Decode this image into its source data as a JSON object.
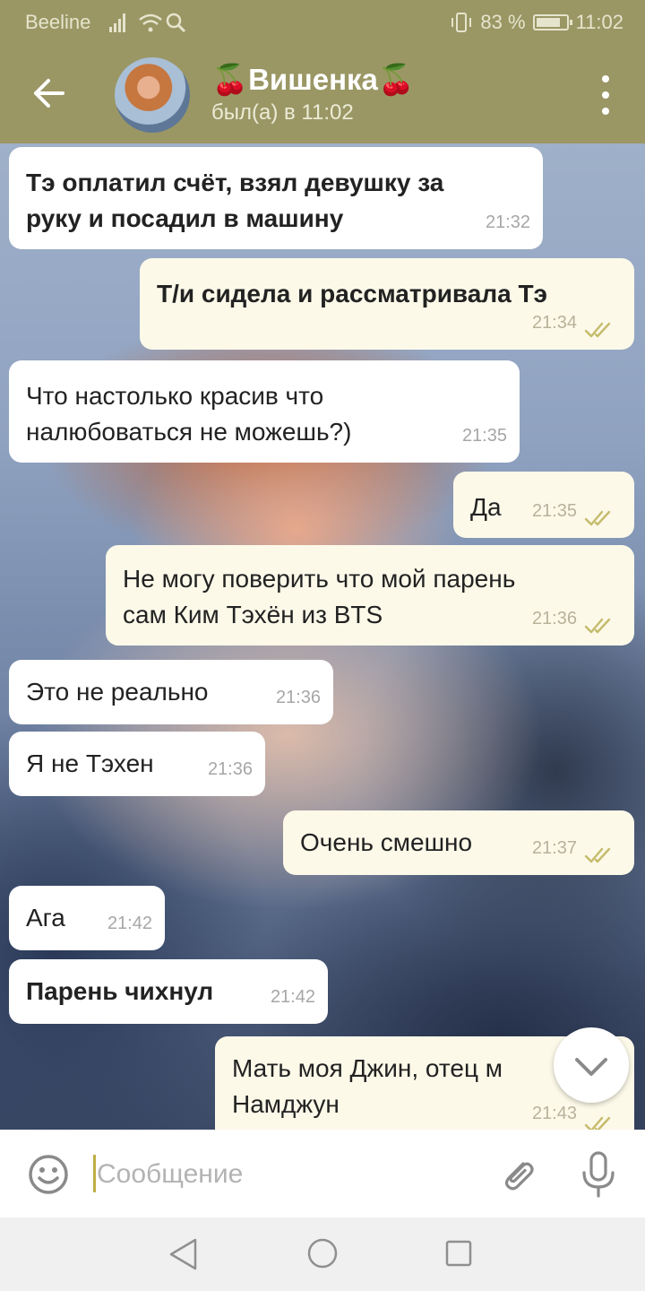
{
  "status_bar": {
    "carrier": "Beeline",
    "battery": "83 %",
    "battery_level": 0.83,
    "time": "11:02"
  },
  "header": {
    "name": "Вишенка",
    "emoji": "🍒",
    "status": "был(а) в 11:02",
    "icons": [
      "back-arrow-icon",
      "avatar",
      "more-vertical-icon"
    ]
  },
  "messages": [
    {
      "direction": "in",
      "text": "Тэ оплатил счёт, взял девушку за\nруку и посадил в машину",
      "time": "21:32",
      "bold": true
    },
    {
      "direction": "out",
      "text": "Т/и сидела и рассматривала Тэ",
      "time": "21:34",
      "bold": true,
      "read": true
    },
    {
      "direction": "in",
      "text": "Что настолько красив что\nналюбоваться не можешь?)",
      "time": "21:35",
      "bold": false
    },
    {
      "direction": "out",
      "text": "Да",
      "time": "21:35",
      "bold": false,
      "read": true
    },
    {
      "direction": "out",
      "text": "Не могу поверить что мой парень\nсам Ким Тэхён из BTS",
      "time": "21:36",
      "bold": false,
      "read": true
    },
    {
      "direction": "in",
      "text": "Это не реально",
      "time": "21:36",
      "bold": false
    },
    {
      "direction": "in",
      "text": "Я не Тэхен",
      "time": "21:36",
      "bold": false
    },
    {
      "direction": "out",
      "text": "Очень смешно",
      "time": "21:37",
      "bold": false,
      "read": true
    },
    {
      "direction": "in",
      "text": "Ага",
      "time": "21:42",
      "bold": false
    },
    {
      "direction": "in",
      "text": "Парень чихнул",
      "time": "21:42",
      "bold": true
    },
    {
      "direction": "out",
      "text": "Мать моя Джин, отец м\nНамджун",
      "time": "21:43",
      "bold": false,
      "read": true
    }
  ],
  "input": {
    "placeholder": "Сообщение",
    "value": ""
  },
  "colors": {
    "header": "#9a9765",
    "incoming_bubble": "#ffffff",
    "outgoing_bubble": "#fcf9e9",
    "read_ticks": "#c5bb6b",
    "caret": "#bfae46"
  }
}
